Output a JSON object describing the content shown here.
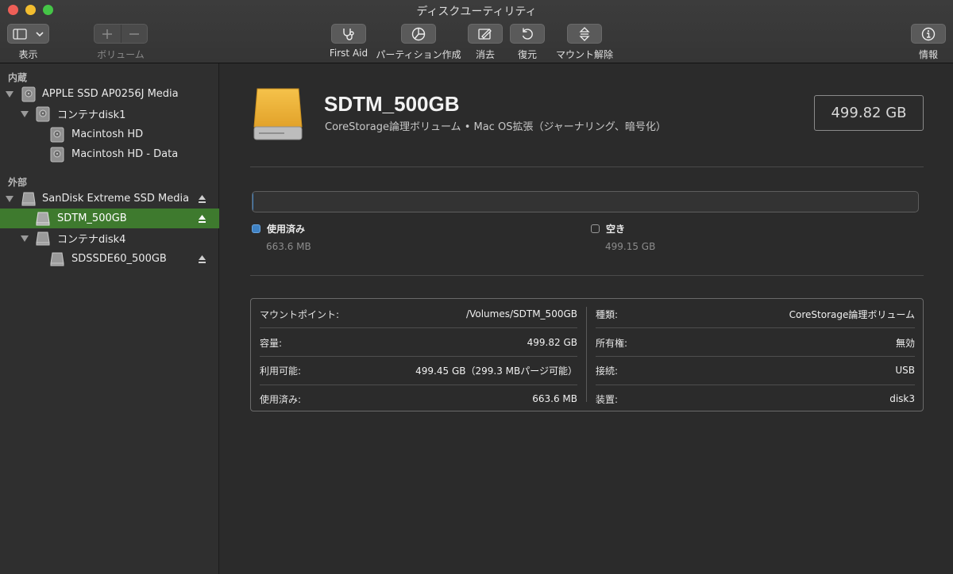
{
  "window": {
    "title": "ディスクユーティリティ"
  },
  "toolbar": {
    "view_label": "表示",
    "volume_label": "ボリューム",
    "first_aid_label": "First Aid",
    "partition_label": "パーティション作成",
    "erase_label": "消去",
    "restore_label": "復元",
    "unmount_label": "マウント解除",
    "info_label": "情報"
  },
  "sidebar": {
    "section_internal": "内蔵",
    "section_external": "外部",
    "items": [
      {
        "label": "APPLE SSD AP0256J Media"
      },
      {
        "label": "コンテナdisk1"
      },
      {
        "label": "Macintosh HD"
      },
      {
        "label": "Macintosh HD - Data"
      },
      {
        "label": "SanDisk Extreme SSD Media"
      },
      {
        "label": "SDTM_500GB"
      },
      {
        "label": "コンテナdisk4"
      },
      {
        "label": "SDSSDE60_500GB"
      }
    ]
  },
  "volume": {
    "name": "SDTM_500GB",
    "description": "CoreStorage論理ボリューム • Mac OS拡張（ジャーナリング、暗号化）",
    "capacity": "499.82 GB",
    "used_fraction": 0.0013
  },
  "usage": {
    "used_label": "使用済み",
    "used_value": "663.6 MB",
    "free_label": "空き",
    "free_value": "499.15 GB",
    "used_color": "#3f82c4"
  },
  "info": {
    "left": [
      {
        "key": "マウントポイント:",
        "value": "/Volumes/SDTM_500GB"
      },
      {
        "key": "容量:",
        "value": "499.82 GB"
      },
      {
        "key": "利用可能:",
        "value": "499.45 GB（299.3 MBパージ可能）"
      },
      {
        "key": "使用済み:",
        "value": "663.6 MB"
      }
    ],
    "right": [
      {
        "key": "種類:",
        "value": "CoreStorage論理ボリューム"
      },
      {
        "key": "所有権:",
        "value": "無効"
      },
      {
        "key": "接続:",
        "value": "USB"
      },
      {
        "key": "装置:",
        "value": "disk3"
      }
    ]
  }
}
